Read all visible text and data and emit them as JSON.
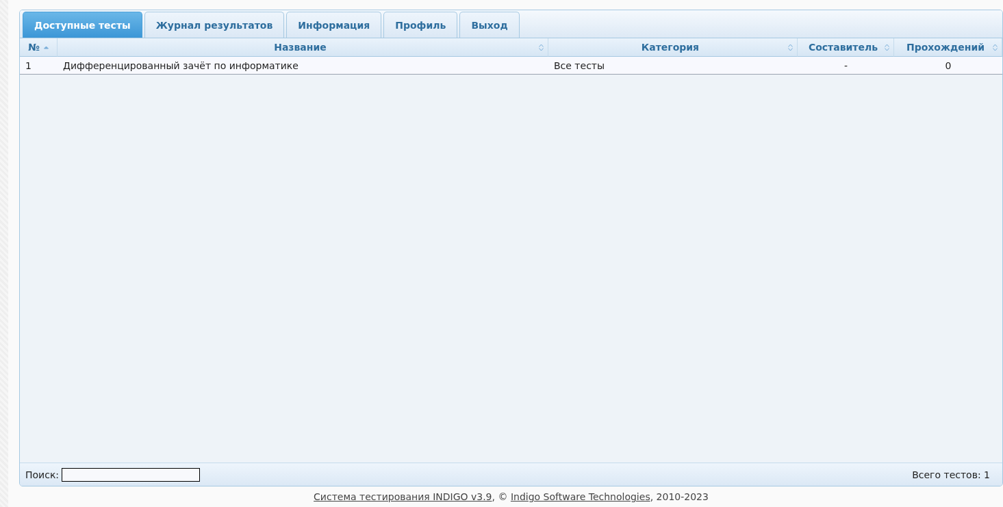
{
  "tabs": [
    {
      "label": "Доступные тесты",
      "selected": true
    },
    {
      "label": "Журнал результатов",
      "selected": false
    },
    {
      "label": "Информация",
      "selected": false
    },
    {
      "label": "Профиль",
      "selected": false
    },
    {
      "label": "Выход",
      "selected": false
    }
  ],
  "table": {
    "columns": [
      {
        "label": "№",
        "sorted": true
      },
      {
        "label": "Название",
        "sorted": false
      },
      {
        "label": "Категория",
        "sorted": false
      },
      {
        "label": "Составитель",
        "sorted": false
      },
      {
        "label": "Прохождений",
        "sorted": false
      }
    ],
    "rows": [
      {
        "cells": [
          "1",
          "Дифференцированный зачёт по информатике",
          "Все тесты",
          "-",
          "0"
        ]
      }
    ]
  },
  "search": {
    "label": "Поиск:"
  },
  "total": "Всего тестов: 1",
  "footer": [
    {
      "kind": "link",
      "text": "Система тестирования INDIGO v3.9"
    },
    {
      "kind": "text",
      "text": ", © "
    },
    {
      "kind": "link",
      "text": "Indigo Software Technologies"
    },
    {
      "kind": "text",
      "text": ", 2010-2023"
    }
  ]
}
